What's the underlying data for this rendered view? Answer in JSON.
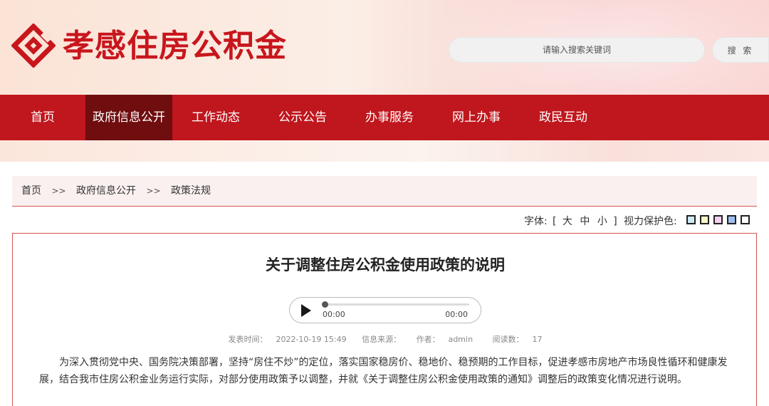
{
  "header": {
    "site_title": "孝感住房公积金",
    "search_placeholder": "请输入搜索关键词",
    "search_button": "搜 索",
    "brand_color": "#c8161d"
  },
  "nav": {
    "items": [
      {
        "label": "首页",
        "active": false
      },
      {
        "label": "政府信息公开",
        "active": true
      },
      {
        "label": "工作动态",
        "active": false
      },
      {
        "label": "公示公告",
        "active": false
      },
      {
        "label": "办事服务",
        "active": false
      },
      {
        "label": "网上办事",
        "active": false
      },
      {
        "label": "政民互动",
        "active": false
      }
    ],
    "bg_color": "#c0161d",
    "active_color": "#6f0d0f"
  },
  "breadcrumb": {
    "items": [
      "首页",
      "政府信息公开",
      "政策法规"
    ],
    "separator": ">>"
  },
  "tools": {
    "font_label": "字体:",
    "font_open": "[",
    "font_sizes": [
      "大",
      "中",
      "小"
    ],
    "font_close": "]",
    "eye_label": "视力保护色:",
    "eye_colors": [
      "#cfe9f3",
      "#f9f6c8",
      "#f3d0f0",
      "#9fbff0",
      "#ffffff"
    ]
  },
  "article": {
    "title": "关于调整住房公积金使用政策的说明",
    "player": {
      "current_time": "00:00",
      "duration": "00:00",
      "progress": 0
    },
    "meta": {
      "publish_label": "发表时间：",
      "publish_time": "2022-10-19 15:49",
      "source_label": "信息来源：",
      "author_label": "作者：",
      "author": "admin",
      "views_label": "阅读数：",
      "views": "17"
    },
    "paragraph": "为深入贯彻党中央、国务院决策部署，坚持“房住不炒”的定位，落实国家稳房价、稳地价、稳预期的工作目标，促进孝感市房地产市场良性循环和健康发展，结合我市住房公积金业务运行实际，对部分使用政策予以调整，并就《关于调整住房公积金使用政策的通知》调整后的政策变化情况进行说明。"
  }
}
